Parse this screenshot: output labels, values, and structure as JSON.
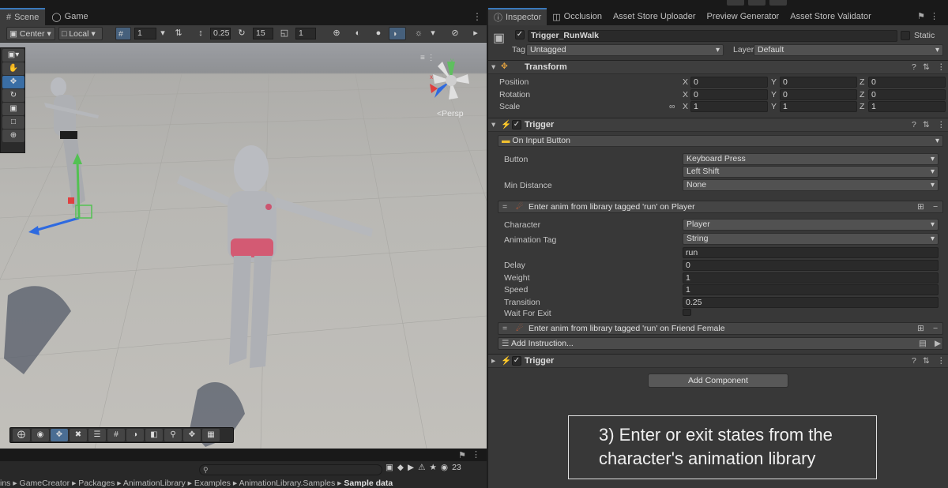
{
  "scene_tabs": {
    "scene": "Scene",
    "game": "Game"
  },
  "toolbar": {
    "center": "Center",
    "local": "Local",
    "grid_value": "1",
    "snap_value": "0.25",
    "angle_value": "15",
    "scale_value": "1"
  },
  "viewport": {
    "persp_label": "Persp",
    "axis_y": "y",
    "axis_x": "x"
  },
  "project": {
    "search_placeholder": "",
    "hidden_count": "23",
    "breadcrumb": [
      "ins",
      "GameCreator",
      "Packages",
      "AnimationLibrary",
      "Examples",
      "AnimationLibrary.Samples",
      "Sample data"
    ]
  },
  "inspector_tabs": [
    "Inspector",
    "Occlusion",
    "Asset Store Uploader",
    "Preview Generator",
    "Asset Store Validator"
  ],
  "object": {
    "name": "Trigger_RunWalk",
    "static_label": "Static",
    "tag_label": "Tag",
    "tag_value": "Untagged",
    "layer_label": "Layer",
    "layer_value": "Default"
  },
  "transform": {
    "title": "Transform",
    "position_label": "Position",
    "position": {
      "x": "0",
      "y": "0",
      "z": "0"
    },
    "rotation_label": "Rotation",
    "rotation": {
      "x": "0",
      "y": "0",
      "z": "0"
    },
    "scale_label": "Scale",
    "scale": {
      "x": "1",
      "y": "1",
      "z": "1"
    }
  },
  "trigger": {
    "title": "Trigger",
    "event": "On Input Button",
    "button_label": "Button",
    "button_value": "Keyboard Press",
    "key_value": "Left Shift",
    "min_distance_label": "Min Distance",
    "min_distance_value": "None"
  },
  "instruction1": {
    "title": "Enter anim from library tagged 'run' on Player",
    "character_label": "Character",
    "character_value": "Player",
    "anim_tag_label": "Animation Tag",
    "anim_tag_type": "String",
    "anim_tag_value": "run",
    "delay_label": "Delay",
    "delay_value": "0",
    "weight_label": "Weight",
    "weight_value": "1",
    "speed_label": "Speed",
    "speed_value": "1",
    "transition_label": "Transition",
    "transition_value": "0.25",
    "wait_label": "Wait For Exit"
  },
  "instruction2": {
    "title": "Enter anim from library tagged 'run' on Friend Female"
  },
  "add_instruction": "Add Instruction...",
  "trigger2": {
    "title": "Trigger"
  },
  "add_component": "Add Component",
  "caption": {
    "line1": "3) Enter or exit states from the",
    "line2": "character's animation library"
  },
  "colors": {
    "accent": "#3a79bb",
    "panel": "#383838",
    "selection": "#46607c"
  }
}
